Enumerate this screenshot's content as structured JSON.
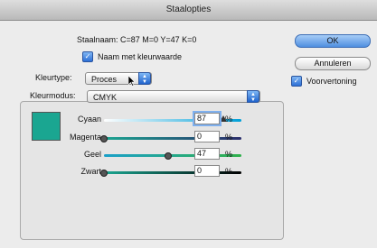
{
  "window": {
    "title": "Staalopties"
  },
  "swatch_name": "Staalnaam: C=87 M=0 Y=47 K=0",
  "name_with_value": {
    "label": "Naam met kleurwaarde",
    "checked": true
  },
  "color_type": {
    "label": "Kleurtype:",
    "value": "Proces"
  },
  "color_mode": {
    "label": "Kleurmodus:",
    "value": "CMYK"
  },
  "swatch_color": "#1aa691",
  "sliders": [
    {
      "label": "Cyaan",
      "value": "87",
      "level": 0.87,
      "unit": "%",
      "gradient": "linear-gradient(90deg,#ffffff,#00a0d8)"
    },
    {
      "label": "Magenta",
      "value": "0",
      "level": 0.0,
      "unit": "%",
      "gradient": "linear-gradient(90deg,#1ba591,#2a2d6b)"
    },
    {
      "label": "Geel",
      "value": "47",
      "level": 0.47,
      "unit": "%",
      "gradient": "linear-gradient(90deg,#1aa0c9,#2fb04a)"
    },
    {
      "label": "Zwart",
      "value": "0",
      "level": 0.0,
      "unit": "%",
      "gradient": "linear-gradient(90deg,#1aa691,#000000)"
    }
  ],
  "buttons": {
    "ok": "OK",
    "cancel": "Annuleren"
  },
  "preview": {
    "label": "Voorvertoning",
    "checked": true
  }
}
